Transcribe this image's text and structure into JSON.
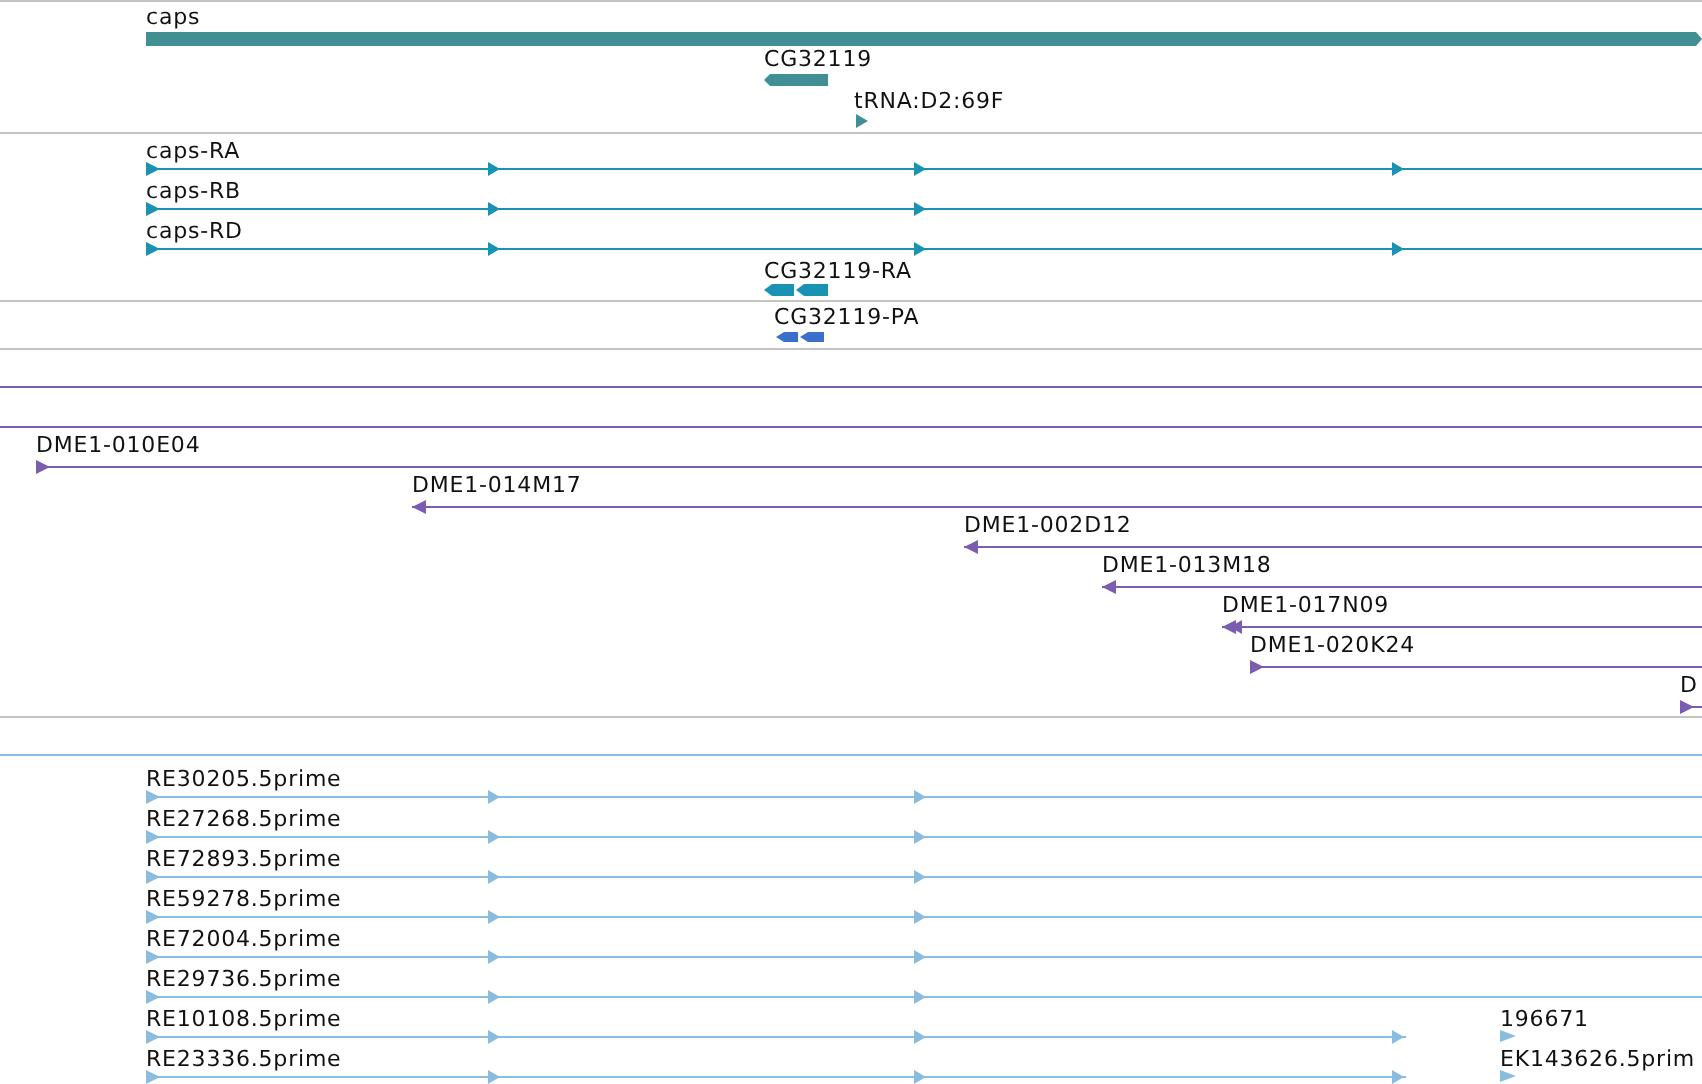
{
  "tracks": [
    {
      "kind": "features",
      "color": "#3f8f93",
      "features": [
        {
          "label": "caps",
          "kind": "block",
          "reverse": false
        },
        {
          "label": "CG32119",
          "kind": "block",
          "reverse": true
        },
        {
          "label": "tRNA:D2:69F",
          "kind": "tick",
          "reverse": false
        }
      ]
    },
    {
      "kind": "features",
      "color": "#1a92b4",
      "features": [
        {
          "label": "caps-RA",
          "kind": "transcript",
          "reverse": false
        },
        {
          "label": "caps-RB",
          "kind": "transcript",
          "reverse": false
        },
        {
          "label": "caps-RD",
          "kind": "transcript",
          "reverse": false
        },
        {
          "label": "CG32119-RA",
          "kind": "segments",
          "reverse": true
        }
      ]
    },
    {
      "kind": "features",
      "color": "#3a6fcc",
      "features": [
        {
          "label": "CG32119-PA",
          "kind": "segments",
          "reverse": true
        }
      ]
    },
    {
      "kind": "empty"
    },
    {
      "kind": "features",
      "color": "#7a5cb0",
      "features": [
        {
          "kind": "span"
        },
        {
          "kind": "span"
        },
        {
          "label": "DME1-010E04",
          "kind": "transcript",
          "reverse": false
        },
        {
          "label": "DME1-014M17",
          "kind": "transcript",
          "reverse": true
        },
        {
          "label": "DME1-002D12",
          "kind": "transcript",
          "reverse": true
        },
        {
          "label": "DME1-013M18",
          "kind": "transcript",
          "reverse": true
        },
        {
          "label": "DME1-017N09",
          "kind": "transcript",
          "reverse": true
        },
        {
          "label": "DME1-020K24",
          "kind": "transcript",
          "reverse": false
        },
        {
          "label": "D",
          "kind": "transcript",
          "reverse": false
        }
      ]
    },
    {
      "kind": "empty"
    },
    {
      "kind": "features",
      "color": "#88bde0",
      "features": [
        {
          "kind": "span"
        },
        {
          "label": "RE30205.5prime",
          "kind": "transcript",
          "reverse": false
        },
        {
          "label": "RE27268.5prime",
          "kind": "transcript",
          "reverse": false
        },
        {
          "label": "RE72893.5prime",
          "kind": "transcript",
          "reverse": false
        },
        {
          "label": "RE59278.5prime",
          "kind": "transcript",
          "reverse": false
        },
        {
          "label": "RE72004.5prime",
          "kind": "transcript",
          "reverse": false
        },
        {
          "label": "RE29736.5prime",
          "kind": "transcript",
          "reverse": false
        },
        {
          "label": "RE10108.5prime",
          "kind": "transcript",
          "reverse": false
        },
        {
          "label": "196671",
          "kind": "tick",
          "reverse": false
        },
        {
          "label": "RE23336.5prime",
          "kind": "transcript",
          "reverse": false
        },
        {
          "label": "EK143626.5prim",
          "kind": "tick",
          "reverse": false
        }
      ]
    }
  ]
}
